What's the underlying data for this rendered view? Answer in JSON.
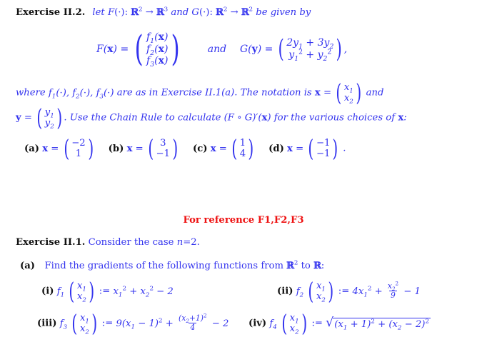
{
  "document": {
    "colors": {
      "heading_black": "#111111",
      "body_blue": "#3333ee",
      "reference_red": "#ee1111",
      "background": "#ffffff"
    },
    "exercise_2": {
      "label": "Exercise II.2.",
      "intro_1": "let",
      "F_name": "F",
      "F_arg": "(·)",
      "colon": ":",
      "arrow": "→",
      "dim_domain": "2",
      "dim_codomain": "3",
      "and_word": "and",
      "G_name": "G",
      "G_arg": "(·)",
      "G_dim_domain": "2",
      "G_dim_codomain": "2",
      "be_given_by": "be given by",
      "F_def_lhs": "F(x) =",
      "F_entries": [
        "f₁(x)",
        "f₂(x)",
        "f₃(x)"
      ],
      "between_defs": "and",
      "G_def_lhs": "G(y) =",
      "G_entries": [
        "2y₁ + 3y₂",
        "y₁² + y₂²"
      ],
      "trailing_comma": ",",
      "where_text": "where",
      "where_funcs": "f₁(·), f₂(·), f₃(·)",
      "where_rest": "are as in Exercise II.1(a).  The notation is",
      "x_eq": "x =",
      "x_entries": [
        "x₁",
        "x₂"
      ],
      "and_word_2": "and",
      "y_eq": "y =",
      "y_entries": [
        "y₁",
        "y₂"
      ],
      "chain_rule_text": ". Use the Chain Rule to calculate",
      "chain_rule_expr": "(F ∘ G)′(x)",
      "chain_rule_tail": "for the various choices of",
      "x_letter": "x",
      "colon_end": ":",
      "choices": [
        {
          "label": "(a)",
          "lhs": "x =",
          "entries": [
            "−2",
            "1"
          ]
        },
        {
          "label": "(b)",
          "lhs": "x =",
          "entries": [
            "3",
            "−1"
          ]
        },
        {
          "label": "(c)",
          "lhs": "x =",
          "entries": [
            "1",
            "4"
          ]
        },
        {
          "label": "(d)",
          "lhs": "x =",
          "entries": [
            "−1",
            "−1"
          ]
        }
      ],
      "choices_period": "."
    },
    "reference_note": "For reference F1,F2,F3",
    "exercise_1": {
      "label": "Exercise II.1.",
      "text": "Consider the case",
      "case_var": "n",
      "case_eq": "=",
      "case_val": "2",
      "period": ".",
      "part_a_label": "(a)",
      "part_a_text_1": "Find the gradients of the following functions from",
      "part_a_dim_from": "2",
      "part_a_text_2": "to",
      "part_a_colon": ":",
      "items": [
        {
          "num": "(i)",
          "fname": "f",
          "fsub": "1",
          "args": [
            "x₁",
            "x₂"
          ],
          "assign": ":=",
          "body": "x₁² + x₂² − 2"
        },
        {
          "num": "(ii)",
          "fname": "f",
          "fsub": "2",
          "args": [
            "x₁",
            "x₂"
          ],
          "assign": ":=",
          "body": "4x₁² + x₂²/9 − 1",
          "frac_num": "x₂²",
          "frac_den": "9"
        },
        {
          "num": "(iii)",
          "fname": "f",
          "fsub": "3",
          "args": [
            "x₁",
            "x₂"
          ],
          "assign": ":=",
          "body": "9(x₁ − 1)² + (x₂+1)²/4 − 2",
          "frac_num": "(x₂+1)²",
          "frac_den": "4"
        },
        {
          "num": "(iv)",
          "fname": "f",
          "fsub": "4",
          "args": [
            "x₁",
            "x₂"
          ],
          "assign": ":=",
          "body": "√((x₁ + 1)² + (x₂ − 2)²)",
          "radicand": "(x₁ + 1)² + (x₂ − 2)²"
        }
      ]
    }
  }
}
